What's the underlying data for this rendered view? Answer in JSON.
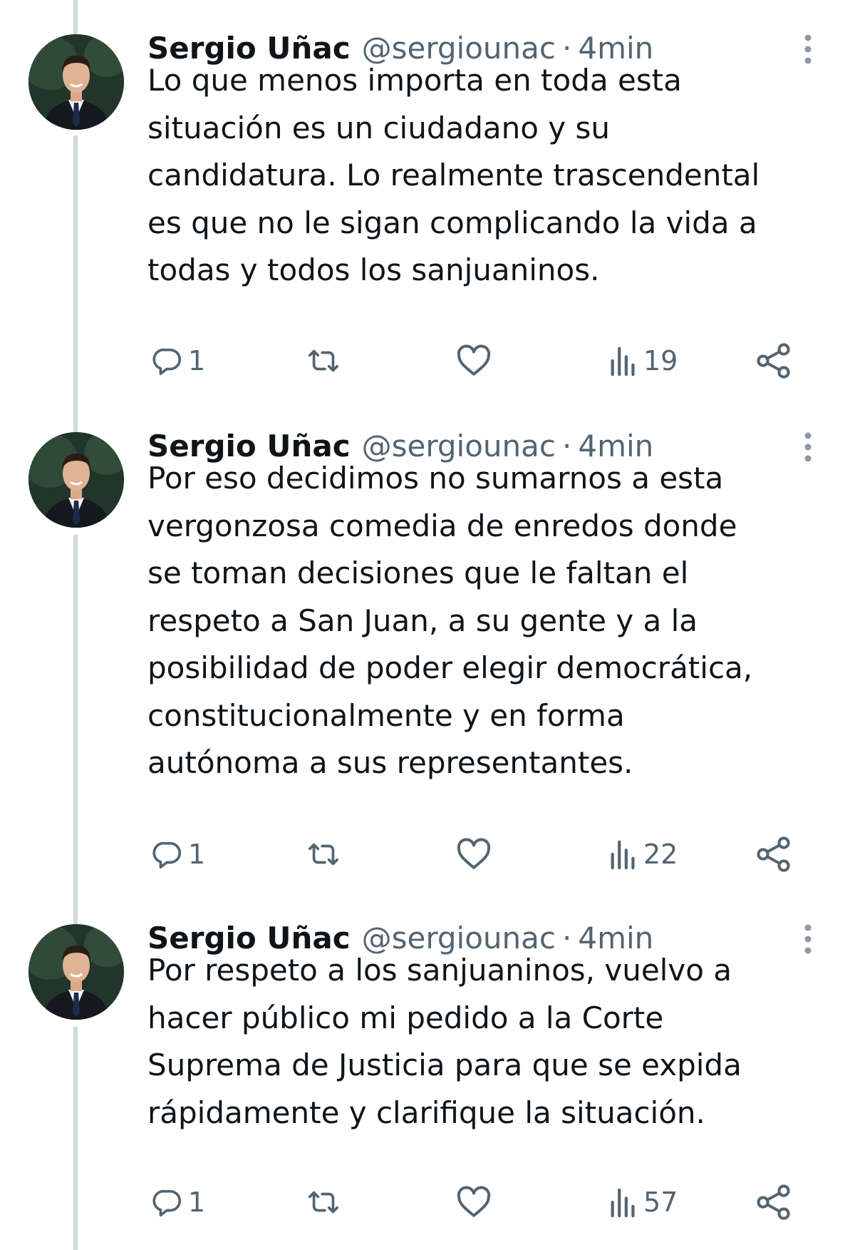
{
  "tweets": [
    {
      "author_name": "Sergio Uñac",
      "author_handle": "@sergiounac",
      "separator": "·",
      "time": "4min",
      "text": "Lo que menos importa en toda esta\nsituación es un ciudadano y su\ncandidatura. Lo realmente trascendental\nes que no le sigan complicando la vida a\ntodas y todos los sanjuaninos.",
      "replies": "1",
      "views": "19"
    },
    {
      "author_name": "Sergio Uñac",
      "author_handle": "@sergiounac",
      "separator": "·",
      "time": "4min",
      "text": "Por eso decidimos no sumarnos a esta\nvergonzosa comedia de enredos donde\nse toman decisiones que le faltan el\nrespeto a San Juan, a su gente y a la\nposibilidad de poder elegir democrática,\nconstitucionalmente y en forma\nautónoma a sus representantes.",
      "replies": "1",
      "views": "22"
    },
    {
      "author_name": "Sergio Uñac",
      "author_handle": "@sergiounac",
      "separator": "·",
      "time": "4min",
      "text": "Por respeto a los sanjuaninos, vuelvo a\nhacer público mi pedido a la Corte\nSuprema de Justicia para que se expida\nrápidamente y clarifique la situación.",
      "replies": "1",
      "views": "57"
    }
  ],
  "icons": {
    "reply": "reply-icon",
    "repost": "repost-icon",
    "like": "heart-icon",
    "views": "views-icon",
    "share": "share-icon",
    "more": "more-options-icon",
    "avatar": "avatar"
  },
  "colors": {
    "text": "#0f1419",
    "secondary": "#536471",
    "thread_line": "#cfd9de",
    "background": "#ffffff"
  }
}
